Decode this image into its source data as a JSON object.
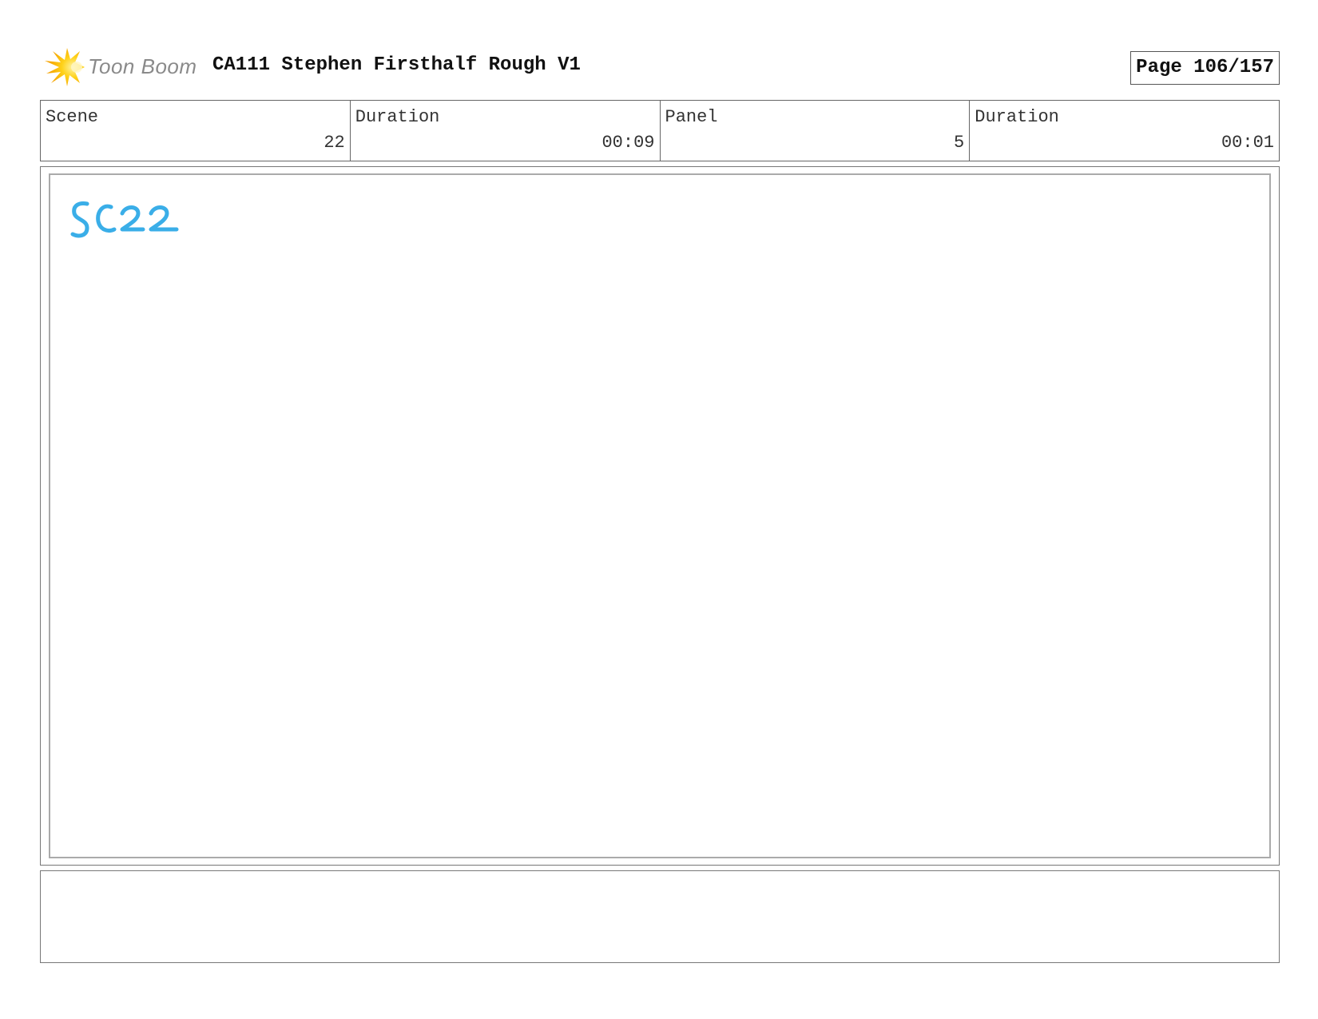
{
  "header": {
    "logo_text": "Toon Boom",
    "title": "CA111 Stephen Firsthalf Rough V1",
    "page_label": "Page 106/157"
  },
  "info": [
    {
      "label": "Scene",
      "value": "22"
    },
    {
      "label": "Duration",
      "value": "00:09"
    },
    {
      "label": "Panel",
      "value": "5"
    },
    {
      "label": "Duration",
      "value": "00:01"
    }
  ],
  "panel": {
    "sketch_text": "SC22",
    "sketch_color": "#3aaee8"
  },
  "notes": {
    "text": ""
  }
}
